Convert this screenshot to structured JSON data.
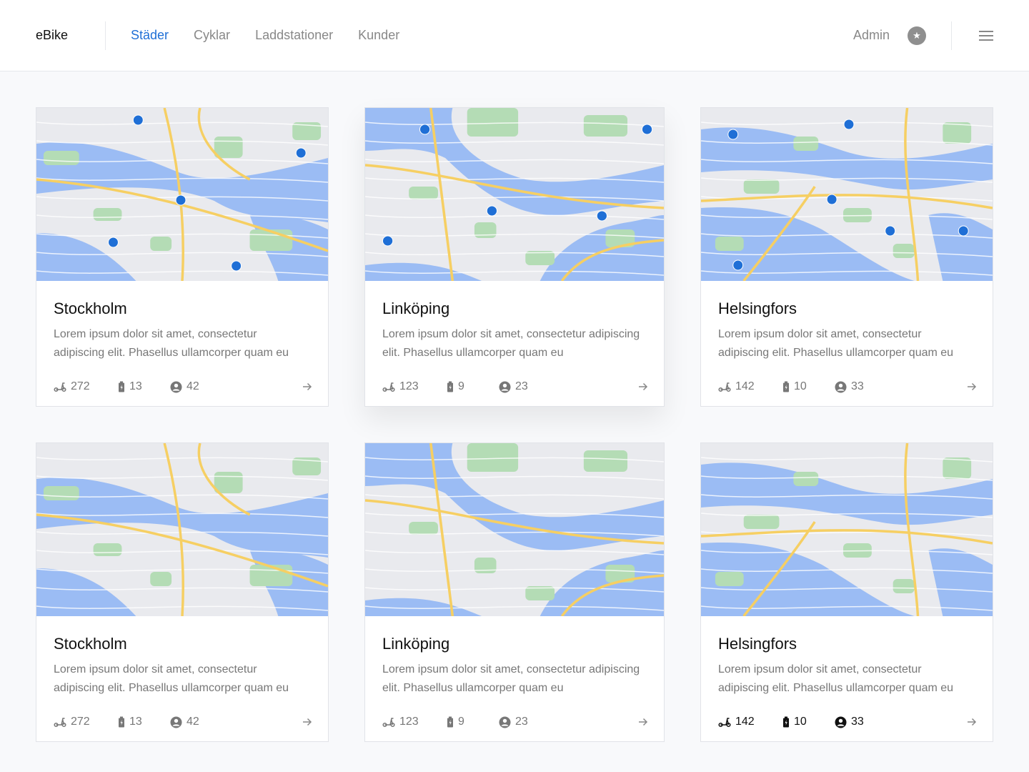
{
  "header": {
    "brand": "eBike",
    "nav": [
      {
        "label": "Städer",
        "active": true
      },
      {
        "label": "Cyklar",
        "active": false
      },
      {
        "label": "Laddstationer",
        "active": false
      },
      {
        "label": "Kunder",
        "active": false
      }
    ],
    "user": "Admin",
    "avatar_icon": "star-icon",
    "menu_icon": "hamburger-icon"
  },
  "colors": {
    "accent": "#1f6fd6",
    "water": "#9bbcf4",
    "park": "#b4dcb5",
    "road": "#f6cf63",
    "land": "#e9eaee",
    "marker": "#1f6fd6"
  },
  "cards": [
    {
      "city": "Stockholm",
      "description": "Lorem ipsum dolor sit amet, consectetur adipiscing elit. Phasellus ullamcorper quam eu",
      "scooters": "272",
      "stations": "13",
      "customers": "42",
      "markers": true
    },
    {
      "city": "Linköping",
      "description": "Lorem ipsum dolor sit amet, consectetur adipiscing elit. Phasellus ullamcorper quam eu",
      "scooters": "123",
      "stations": "9",
      "customers": "23",
      "markers": true
    },
    {
      "city": "Helsingfors",
      "description": "Lorem ipsum dolor sit amet, consectetur adipiscing elit. Phasellus ullamcorper quam eu",
      "scooters": "142",
      "stations": "10",
      "customers": "33",
      "markers": true
    },
    {
      "city": "Stockholm",
      "description": "Lorem ipsum dolor sit amet, consectetur adipiscing elit. Phasellus ullamcorper quam eu",
      "scooters": "272",
      "stations": "13",
      "customers": "42",
      "markers": false
    },
    {
      "city": "Linköping",
      "description": "Lorem ipsum dolor sit amet, consectetur adipiscing elit. Phasellus ullamcorper quam eu",
      "scooters": "123",
      "stations": "9",
      "customers": "23",
      "markers": false
    },
    {
      "city": "Helsingfors",
      "description": "Lorem ipsum dolor sit amet, consectetur adipiscing elit. Phasellus ullamcorper quam eu",
      "scooters": "142",
      "stations": "10",
      "customers": "33",
      "markers": false
    }
  ]
}
